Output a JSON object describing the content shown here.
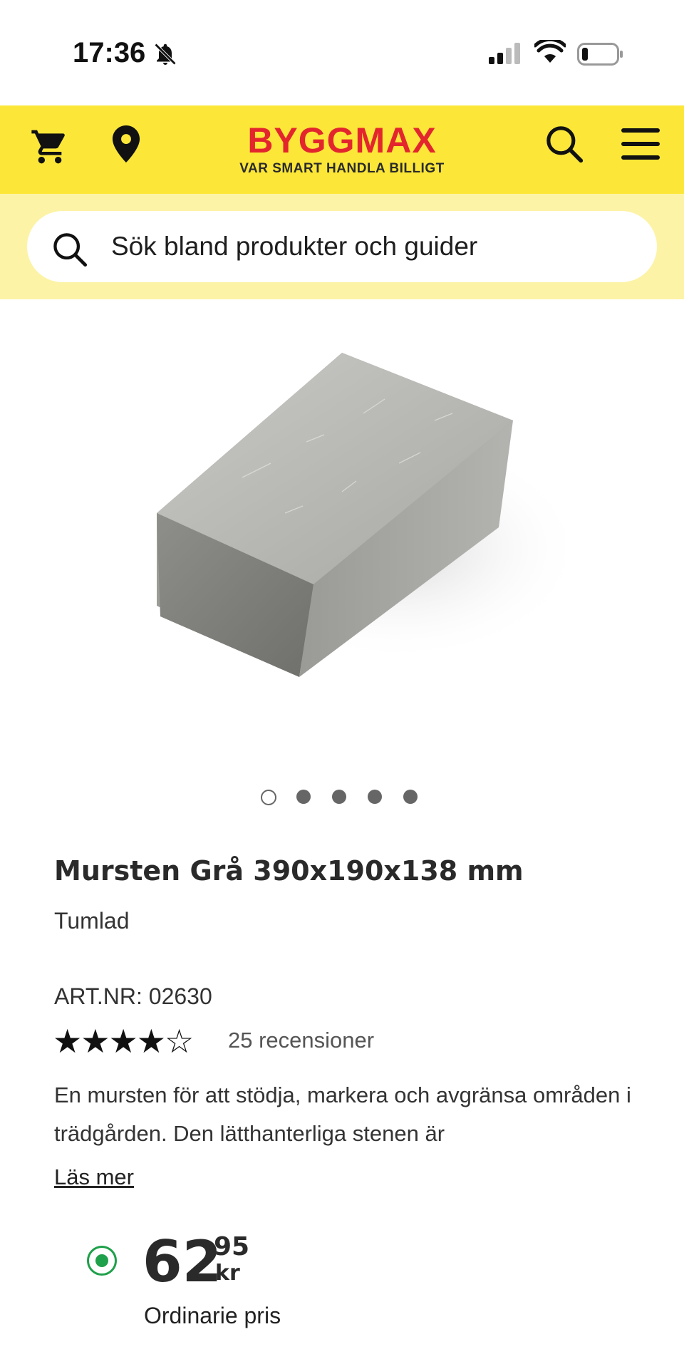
{
  "status_bar": {
    "time": "17:36",
    "icons": [
      "bell-muted-icon",
      "signal-icon",
      "wifi-icon",
      "battery-icon"
    ]
  },
  "header": {
    "logo_title": "BYGGMAX",
    "logo_tagline": "VAR SMART HANDLA BILLIGT",
    "icons": [
      "cart-icon",
      "location-icon",
      "search-icon",
      "menu-icon"
    ],
    "background_color": "#fce739",
    "logo_color": "#e3262e"
  },
  "search": {
    "placeholder": "Sök bland produkter och guider"
  },
  "product": {
    "image": "concrete-brick-image",
    "carousel_count": 5,
    "carousel_active_index": 0,
    "title": "Mursten Grå 390x190x138 mm",
    "subtitle": "Tumlad",
    "art_nr": "ART.NR: 02630",
    "rating": 4,
    "rating_max": 5,
    "rating_stars": "★★★★☆",
    "review_count": "25 recensioner",
    "description": "En mursten för att stödja, markera och avgränsa områden i trädgården. Den lätthanterliga stenen är",
    "read_more": "Läs mer"
  },
  "price": {
    "main": "62",
    "decimals": "95",
    "currency": "kr",
    "label": "Ordinarie pris",
    "selected": true,
    "radio_color": "#1fa04a"
  }
}
